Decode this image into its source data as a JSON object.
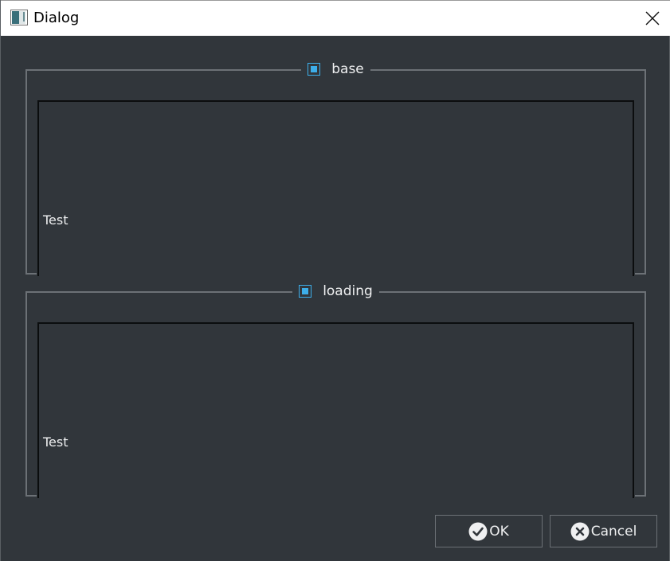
{
  "window": {
    "title": "Dialog"
  },
  "groups": [
    {
      "label": "base",
      "checked": true,
      "content_text": "Test"
    },
    {
      "label": "loading",
      "checked": true,
      "content_text": "Test"
    }
  ],
  "buttons": {
    "ok_label": "OK",
    "cancel_label": "Cancel"
  },
  "icons": {
    "app": "app-window-icon",
    "close": "close-icon",
    "ok": "check-circle-icon",
    "cancel": "x-circle-icon"
  },
  "colors": {
    "background": "#31363b",
    "accent": "#3daee9",
    "text": "#eff0f1",
    "border": "#6c7176",
    "frame": "#0b0d0e"
  }
}
